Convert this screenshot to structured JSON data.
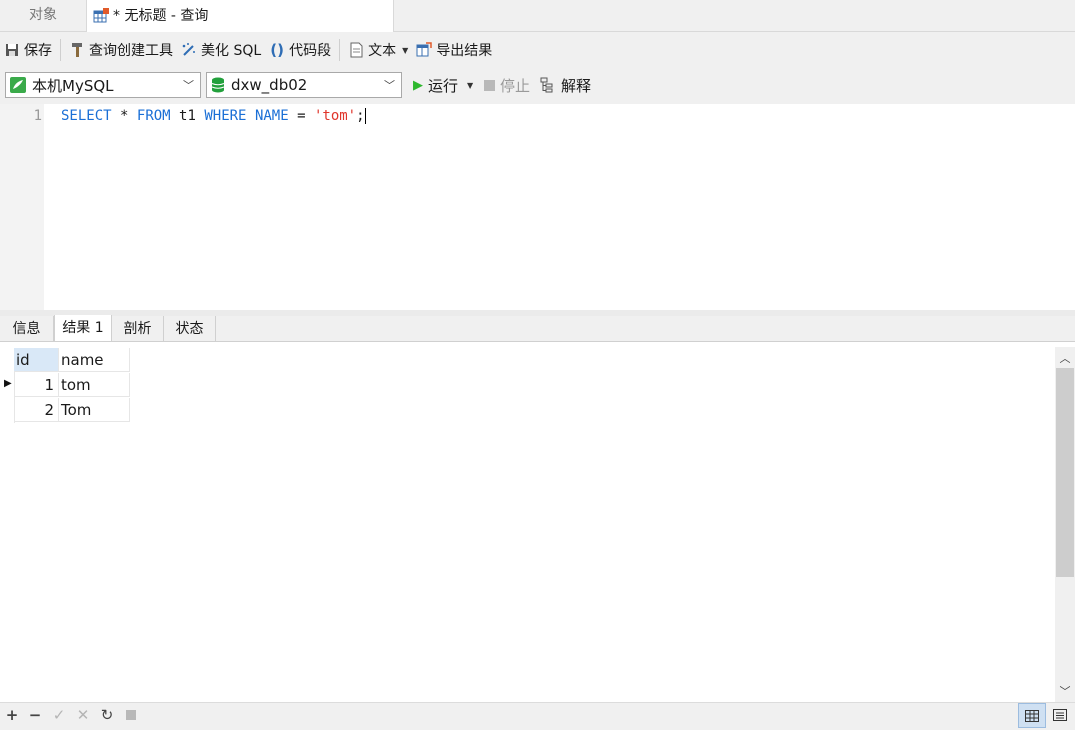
{
  "tabs": {
    "objects": "对象",
    "query": "* 无标题 - 查询"
  },
  "toolbar": {
    "save": "保存",
    "query_builder": "查询创建工具",
    "beautify": "美化 SQL",
    "code_snippet": "代码段",
    "text": "文本",
    "export": "导出结果"
  },
  "connection": {
    "selected": "本机MySQL"
  },
  "database": {
    "selected": "dxw_db02"
  },
  "run": {
    "run_label": "运行",
    "stop_label": "停止",
    "explain_label": "解释"
  },
  "editor": {
    "line_number": "1",
    "tokens": [
      "SELECT",
      "*",
      "FROM",
      "t1",
      "WHERE",
      "NAME",
      "=",
      "'tom'",
      ";"
    ]
  },
  "result_tabs": {
    "info": "信息",
    "result1": "结果 1",
    "profile": "剖析",
    "status": "状态"
  },
  "grid": {
    "columns": [
      "id",
      "name"
    ],
    "rows": [
      {
        "id": "1",
        "name": "tom"
      },
      {
        "id": "2",
        "name": "Tom"
      }
    ]
  },
  "colors": {
    "keyword": "#1a6fd6",
    "string": "#e0352b",
    "run_green": "#2eb82e",
    "db_green": "#22a03c"
  }
}
